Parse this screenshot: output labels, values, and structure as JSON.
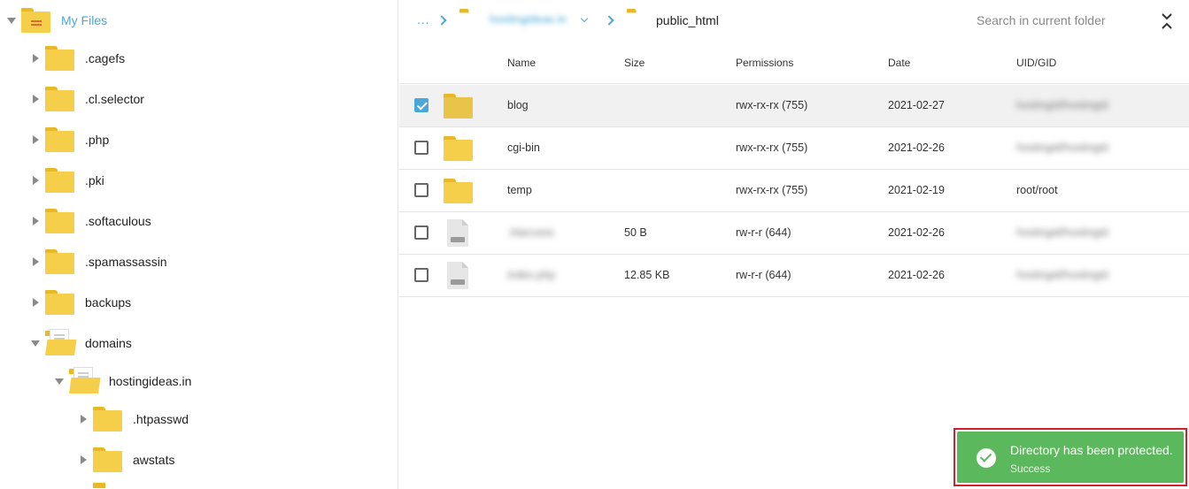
{
  "tree": {
    "root": {
      "label": "My Files"
    },
    "items": [
      {
        "label": ".cagefs"
      },
      {
        "label": ".cl.selector"
      },
      {
        "label": ".php"
      },
      {
        "label": ".pki"
      },
      {
        "label": ".softaculous"
      },
      {
        "label": ".spamassassin"
      },
      {
        "label": "backups"
      },
      {
        "label": "domains"
      },
      {
        "label": "hostingideas.in"
      },
      {
        "label": ".htpasswd"
      },
      {
        "label": "awstats"
      }
    ]
  },
  "breadcrumb": {
    "ellipsis": "...",
    "domain": "hostingideas.in",
    "current": "public_html"
  },
  "search": {
    "placeholder": "Search in current folder"
  },
  "table": {
    "headers": {
      "name": "Name",
      "size": "Size",
      "permissions": "Permissions",
      "date": "Date",
      "uid": "UID/GID"
    },
    "rows": [
      {
        "name": "blog",
        "size": "",
        "permissions": "rwx-rx-rx (755)",
        "date": "2021-02-27",
        "uid": "hostingid/hostingid"
      },
      {
        "name": "cgi-bin",
        "size": "",
        "permissions": "rwx-rx-rx (755)",
        "date": "2021-02-26",
        "uid": "hostingid/hostingid"
      },
      {
        "name": "temp",
        "size": "",
        "permissions": "rwx-rx-rx (755)",
        "date": "2021-02-19",
        "uid": "root/root"
      },
      {
        "name": ".htaccess",
        "size": "50 B",
        "permissions": "rw-r-r (644)",
        "date": "2021-02-26",
        "uid": "hostingid/hostingid"
      },
      {
        "name": "index.php",
        "size": "12.85 KB",
        "permissions": "rw-r-r (644)",
        "date": "2021-02-26",
        "uid": "hostingid/hostingid"
      }
    ]
  },
  "toast": {
    "title": "Directory has been protected.",
    "subtitle": "Success"
  }
}
